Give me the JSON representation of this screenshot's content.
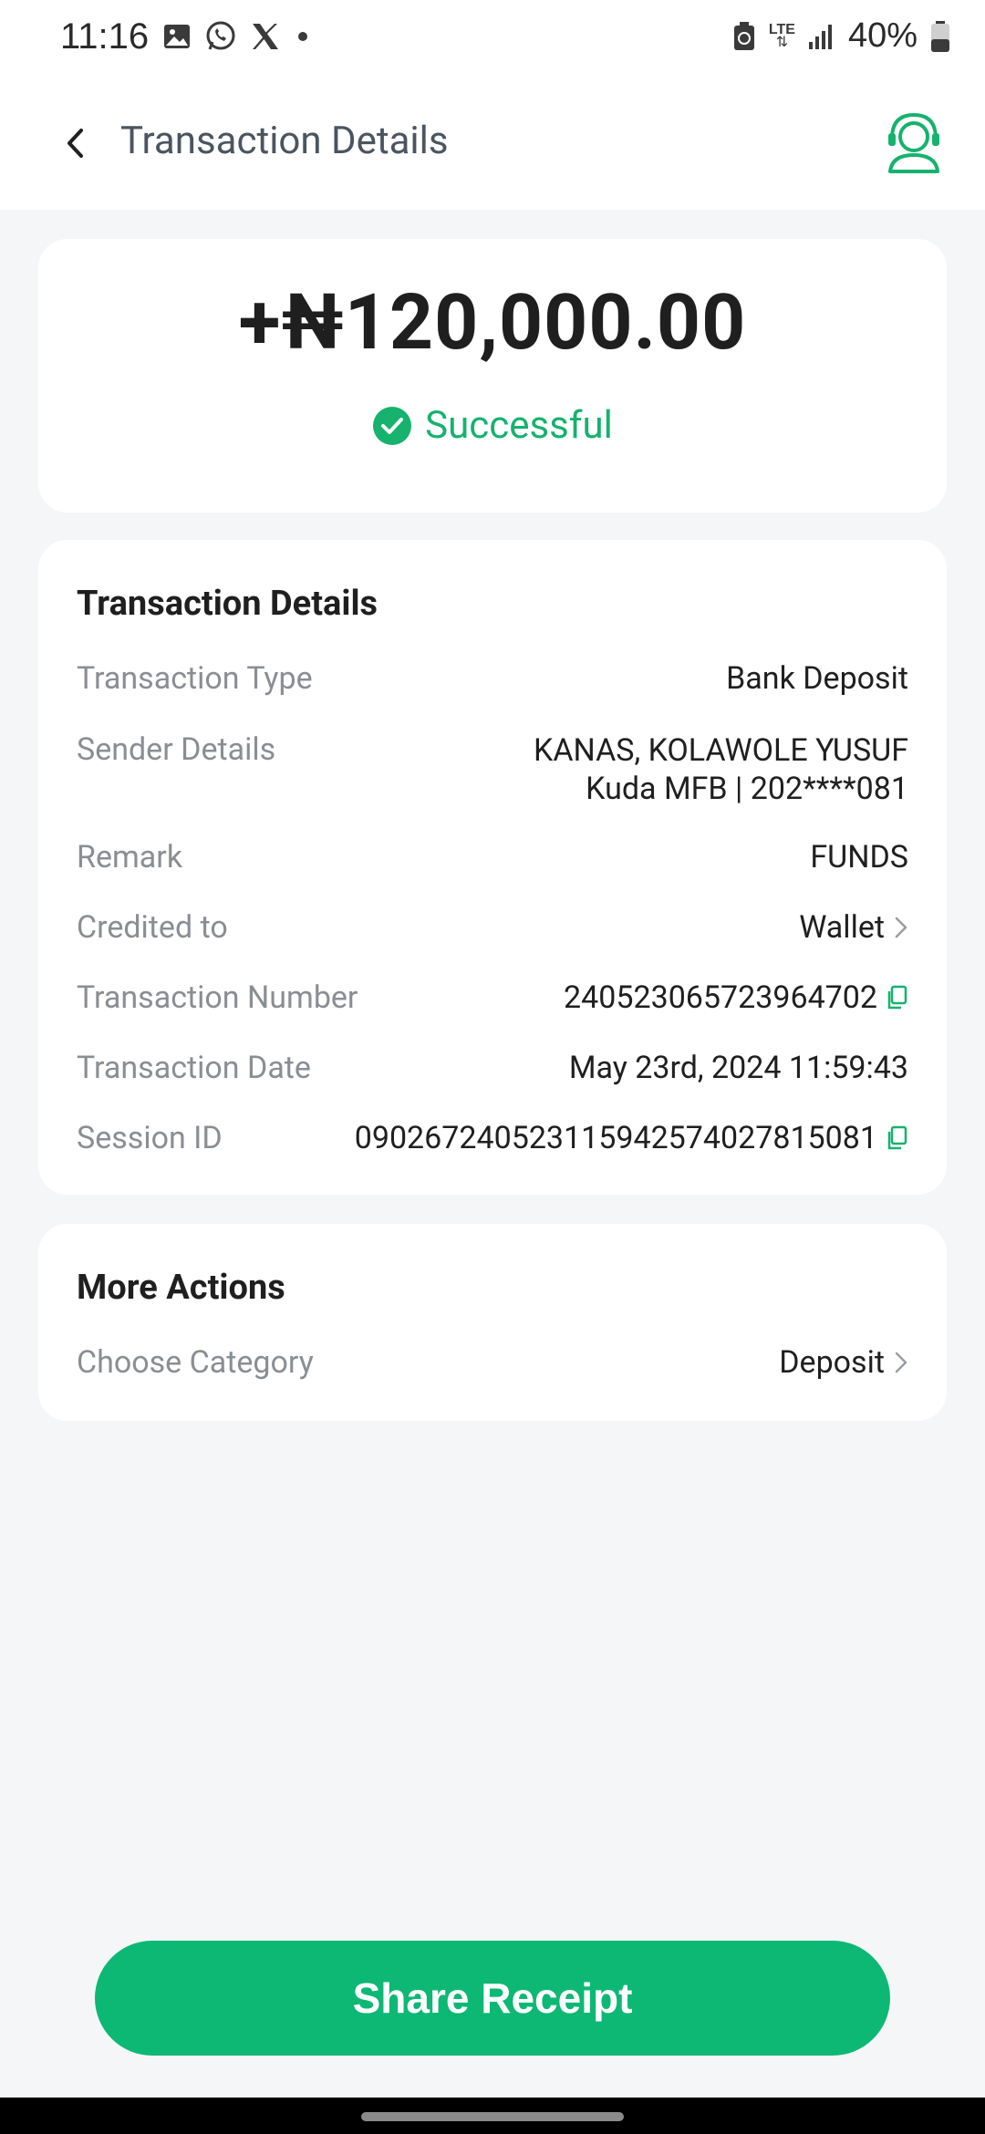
{
  "status_bar": {
    "time": "11:16",
    "battery": "40%",
    "network": "LTE"
  },
  "app_bar": {
    "title": "Transaction Details"
  },
  "amount_card": {
    "amount": "+₦120,000.00",
    "status": "Successful"
  },
  "details": {
    "title": "Transaction Details",
    "rows": [
      {
        "label": "Transaction Type",
        "value": "Bank Deposit"
      },
      {
        "label": "Sender Details",
        "value": "KANAS, KOLAWOLE YUSUF",
        "value2": "Kuda MFB | 202****081"
      },
      {
        "label": "Remark",
        "value": "FUNDS"
      },
      {
        "label": "Credited to",
        "value": "Wallet"
      },
      {
        "label": "Transaction Number",
        "value": "240523065723964702"
      },
      {
        "label": "Transaction Date",
        "value": "May 23rd, 2024 11:59:43"
      },
      {
        "label": "Session ID",
        "value": "090267240523115942574027815081"
      }
    ]
  },
  "more_actions": {
    "title": "More Actions",
    "category_label": "Choose Category",
    "category_value": "Deposit"
  },
  "share_button": "Share Receipt",
  "colors": {
    "accent": "#0db874",
    "success": "#16b26e",
    "background": "#f5f6f8"
  }
}
